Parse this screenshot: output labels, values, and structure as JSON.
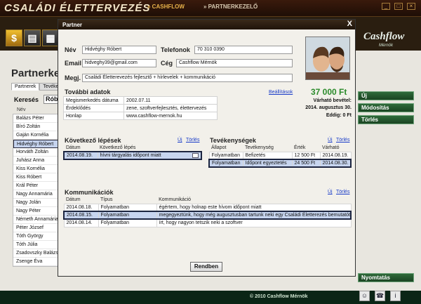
{
  "app": {
    "title": "CSALÁDI ÉLETTERVEZÉS",
    "nav": [
      "» CASHFLOW",
      "» PARTNERKEZELŐ"
    ],
    "window_controls": [
      "_",
      "□",
      "×"
    ]
  },
  "background": {
    "heading": "Partnerke",
    "tabs": [
      "Partnerek",
      "Tevéken"
    ],
    "search_label": "Keresés",
    "search_value": "Rób",
    "list_header": "Név",
    "list": [
      "Balázs Péter",
      "Bíró Zoltán",
      "Gaján Kornélia",
      "Hidvéghy Róbert",
      "Horváth Zoltán",
      "Juhász Anna",
      "Kiss Kornélia",
      "Kiss Róbert",
      "Král Péter",
      "Nagy Annamária",
      "Nagy Jolán",
      "Nagy Péter",
      "Németh Annamária",
      "Péter József",
      "Tóth György",
      "Tóth Júlia",
      "Zsadovszky Balázs",
      "Zsenge Éva"
    ],
    "selected_index": 3,
    "brand": "Cashflow",
    "brand_sub": "Mérnök",
    "side_buttons": [
      "Új",
      "Módosítás",
      "Törlés"
    ],
    "print_button": "Nyomtatás",
    "footer": "© 2010 Cashflow Mérnök"
  },
  "dialog": {
    "title": "Partner",
    "close": "X",
    "fields": {
      "name_label": "Név",
      "name_value": "Hidvéghy Róbert",
      "phone_label": "Telefonok",
      "phone_value": "70 310 0390",
      "email_label": "Email",
      "email_value": "hidveghy39@gmail.com",
      "company_label": "Cég",
      "company_value": "Cashflow Mérnök",
      "note_label": "Megj.",
      "note_value": "Családi Életterevezés fejlesztő + hírlevelek + kommunikáció"
    },
    "extra": {
      "title": "További adatok",
      "settings_link": "Beállítások",
      "rows": [
        {
          "k": "Megismerkedés dátuma",
          "v": "2002.07.11"
        },
        {
          "k": "Érdeklődés",
          "v": "zene, szoftverfejlesztés, élettervezés"
        },
        {
          "k": "Honlap",
          "v": "www.cashflow-mernok.hu"
        }
      ]
    },
    "income": {
      "amount": "37 000 Ft",
      "expected_label": "Várható bevétel:",
      "date_line": "2014. augusztus 30.",
      "so_far_line": "Eddig: 0 Ft"
    },
    "next_steps": {
      "title": "Következő lépések",
      "new": "Új",
      "delete": "Törlés",
      "headers": [
        "Dátum",
        "Következő lépés"
      ],
      "rows": [
        {
          "date": "2014.08.19.",
          "step": "hívni tárgyalás időpont miatt"
        }
      ]
    },
    "activities": {
      "title": "Tevékenységek",
      "new": "Új",
      "delete": "Törlés",
      "headers": [
        "Állapot",
        "Tevékenység",
        "Érték",
        "Várható"
      ],
      "rows": [
        {
          "status": "Folyamatban",
          "activity": "Befizetés",
          "value": "12 500 Ft",
          "expected": "2014.08.19."
        },
        {
          "status": "Folyamatban",
          "activity": "Időpont egyeztetés",
          "value": "24 500 Ft",
          "expected": "2014.08.30."
        }
      ]
    },
    "communication": {
      "title": "Kommunikációk",
      "new": "Új",
      "delete": "Törlés",
      "headers": [
        "Dátum",
        "Típus",
        "Kommunikáció"
      ],
      "rows": [
        {
          "date": "2014.08.18.",
          "type": "Folyamatban",
          "text": "égértem, hogy holnap este hívom időpont miatt"
        },
        {
          "date": "2014.08.15.",
          "type": "Folyamatban",
          "text": "megegyeztünk, hogy még augusztusban tartunk neki egy Családi Életterezés bemutatót"
        },
        {
          "date": "2014.08.14.",
          "type": "Folyamatban",
          "text": "írt, hogy nagyon tetszik neki a szoftver"
        }
      ]
    },
    "ok_button": "Rendben"
  }
}
